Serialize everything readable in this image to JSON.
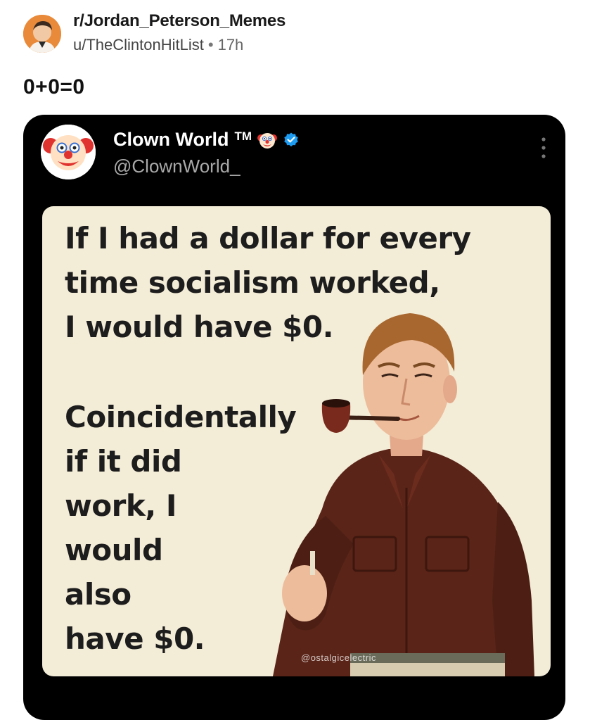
{
  "post": {
    "subreddit": "r/Jordan_Peterson_Memes",
    "username": "u/TheClintonHitList",
    "separator": "•",
    "age": "17h",
    "title": "0+0=0",
    "icons": {
      "subreddit_avatar": "subreddit-avatar-icon"
    }
  },
  "tweet": {
    "display_name": "Clown World",
    "trademark": "TM",
    "handle": "@ClownWorld_",
    "icons": {
      "avatar": "clown-face-avatar-icon",
      "name_emoji": "clown-emoji-icon",
      "verified": "verified-badge-icon",
      "more": "more-options-icon"
    },
    "colors": {
      "card_background": "#000000",
      "verified_blue": "#1d9bf0",
      "handle_gray": "#a9a9a9"
    }
  },
  "meme": {
    "background": "#f3ecd7",
    "text_block_1": [
      "If I had a dollar for every",
      "time socialism worked,",
      "I would have $0."
    ],
    "text_block_2": [
      "Coincidentally",
      "if it did",
      "work, I",
      "would",
      "also",
      "have $0."
    ],
    "illustration": "man-smoking-pipe-illustration",
    "watermark": "@ostalgicelectric"
  }
}
